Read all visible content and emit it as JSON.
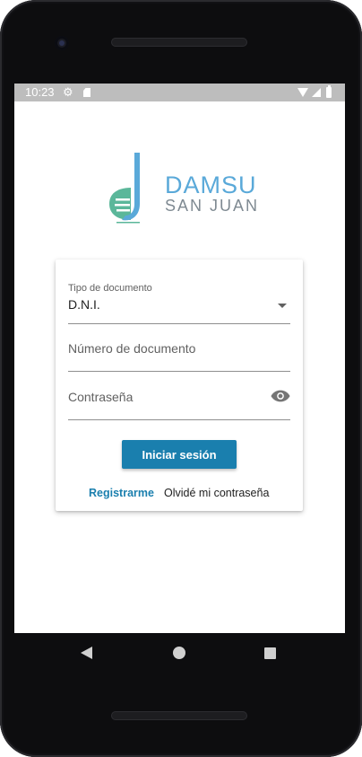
{
  "status_bar": {
    "time": "10:23",
    "icons": [
      "gear-icon",
      "sd-card-icon",
      "wifi-icon",
      "signal-icon",
      "battery-icon"
    ]
  },
  "logo": {
    "line1": "DAMSU",
    "line2": "SAN JUAN",
    "colors": {
      "blue": "#5aa9d9",
      "green": "#5bb79a",
      "gray": "#7f8a92"
    }
  },
  "form": {
    "doc_type": {
      "label": "Tipo de documento",
      "value": "D.N.I."
    },
    "doc_number": {
      "placeholder": "Número de documento"
    },
    "password": {
      "placeholder": "Contraseña"
    }
  },
  "actions": {
    "login": "Iniciar sesión",
    "register": "Registrarme",
    "forgot": "Olvidé mi contraseña"
  },
  "theme": {
    "primary": "#1a7fae",
    "status_bar": "#bdbdbd"
  },
  "nav_bar": {
    "icons": [
      "back-icon",
      "home-icon",
      "recent-apps-icon"
    ]
  }
}
